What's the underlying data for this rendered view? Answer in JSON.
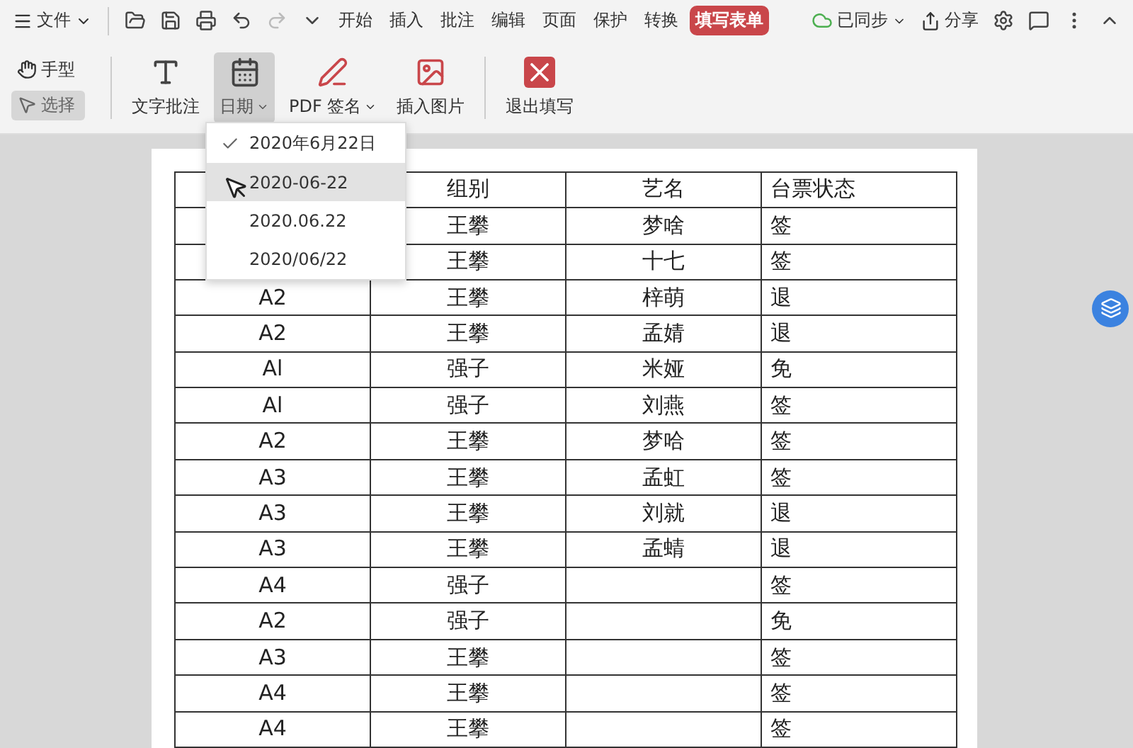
{
  "menu_bar": {
    "file_menu": "文件",
    "quick_tools": [
      {
        "kind": "open",
        "disabled": false
      },
      {
        "kind": "save",
        "disabled": false
      },
      {
        "kind": "print",
        "disabled": false
      },
      {
        "kind": "undo",
        "disabled": false
      },
      {
        "kind": "redo",
        "disabled": true
      },
      {
        "kind": "more",
        "disabled": false
      }
    ],
    "tabs": [
      {
        "label": "开始",
        "selected": false
      },
      {
        "label": "插入",
        "selected": false
      },
      {
        "label": "批注",
        "selected": false
      },
      {
        "label": "编辑",
        "selected": false
      },
      {
        "label": "页面",
        "selected": false
      },
      {
        "label": "保护",
        "selected": false
      },
      {
        "label": "转换",
        "selected": false
      },
      {
        "label": "填写表单",
        "selected": true
      }
    ],
    "sync": "已同步",
    "share": "分享"
  },
  "ribbon": {
    "modes": [
      {
        "kind": "hand",
        "label": "手型",
        "selected": false
      },
      {
        "kind": "select",
        "label": "选择",
        "selected": true
      }
    ],
    "tools": [
      {
        "kind": "text",
        "label": "文字批注",
        "selected": false,
        "dropdown": false
      },
      {
        "kind": "date",
        "label": "日期",
        "selected": true,
        "dropdown": true
      },
      {
        "kind": "sign",
        "label": "PDF 签名",
        "selected": false,
        "dropdown": true
      },
      {
        "kind": "image",
        "label": "插入图片",
        "selected": false,
        "dropdown": false
      },
      {
        "kind": "exit",
        "label": "退出填写",
        "selected": false,
        "dropdown": false
      }
    ]
  },
  "date_menu": [
    {
      "label": "2020年6月22日",
      "checked": true,
      "selected": false
    },
    {
      "label": "2020-06-22",
      "checked": false,
      "selected": true
    },
    {
      "label": "2020.06.22",
      "checked": false,
      "selected": false
    },
    {
      "label": "2020/06/22",
      "checked": false,
      "selected": false
    }
  ],
  "table": {
    "columns": [
      "组别",
      "艺名",
      "台票状态"
    ],
    "rows": [
      {
        "group": "王攀",
        "name": "梦啥",
        "status": "签"
      },
      {
        "group": "王攀",
        "name": "十七",
        "status": "签"
      },
      {
        "code": "A2",
        "group": "王攀",
        "name": "梓萌",
        "status": "退"
      },
      {
        "code": "A2",
        "group": "王攀",
        "name": "孟婧",
        "status": "退"
      },
      {
        "code": "Al",
        "group": "强子",
        "name": "米娅",
        "status": "免"
      },
      {
        "code": "Al",
        "group": "强子",
        "name": "刘燕",
        "status": "签"
      },
      {
        "code": "A2",
        "group": "王攀",
        "name": "梦哈",
        "status": "签"
      },
      {
        "code": "A3",
        "group": "王攀",
        "name": "孟虹",
        "status": "签"
      },
      {
        "code": "A3",
        "group": "王攀",
        "name": "刘就",
        "status": "退"
      },
      {
        "code": "A3",
        "group": "王攀",
        "name": "孟蜻",
        "status": "退"
      },
      {
        "code": "A4",
        "group": "强子",
        "status": "签"
      },
      {
        "code": "A2",
        "group": "强子",
        "status": "免"
      },
      {
        "code": "A3",
        "group": "王攀",
        "status": "签"
      },
      {
        "code": "A4",
        "group": "王攀",
        "status": "签"
      },
      {
        "code": "A4",
        "group": "王攀",
        "status": "签"
      }
    ]
  }
}
